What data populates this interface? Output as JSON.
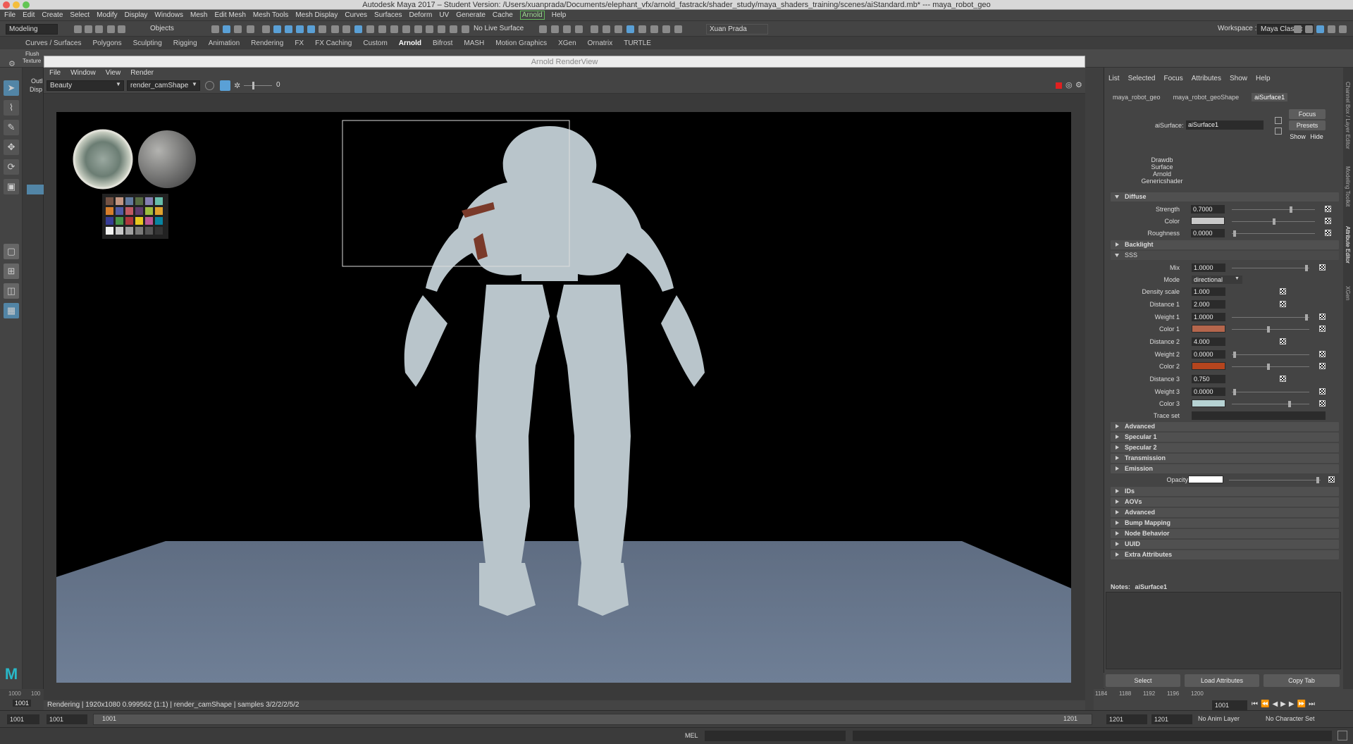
{
  "window": {
    "title": "Autodesk Maya 2017 – Student Version: /Users/xuanprada/Documents/elephant_vfx/arnold_fastrack/shader_study/maya_shaders_training/scenes/aiStandard.mb*  ---  maya_robot_geo"
  },
  "menubar": [
    "File",
    "Edit",
    "Create",
    "Select",
    "Modify",
    "Display",
    "Windows",
    "Mesh",
    "Edit Mesh",
    "Mesh Tools",
    "Mesh Display",
    "Curves",
    "Surfaces",
    "Deform",
    "UV",
    "Generate",
    "Cache",
    "Arnold",
    "Help"
  ],
  "statusline": {
    "mode": "Modeling",
    "selection_mode": "Objects",
    "live_surface": "No Live Surface",
    "user": "Xuan Prada",
    "workspace_label": "Workspace :",
    "workspace": "Maya Classic"
  },
  "shelf_tabs": [
    "Curves / Surfaces",
    "Polygons",
    "Sculpting",
    "Rigging",
    "Animation",
    "Rendering",
    "FX",
    "FX Caching",
    "Custom",
    "Arnold",
    "Bifrost",
    "MASH",
    "Motion Graphics",
    "XGen",
    "Ornatrix",
    "TURTLE"
  ],
  "shelf_icons": {
    "flush": "Flush",
    "texture": "Texture"
  },
  "outliner": {
    "tab": "Outl",
    "disp": "Disp"
  },
  "renderview": {
    "title": "Arnold RenderView",
    "menu": [
      "File",
      "Window",
      "View",
      "Render"
    ],
    "aov": "Beauty",
    "camera": "render_camShape",
    "exposure": "0",
    "status": "Rendering | 1920x1080 0.999562 (1:1) | render_camShape | samples 3/2/2/2/5/2"
  },
  "attribute_editor": {
    "menu": [
      "List",
      "Selected",
      "Focus",
      "Attributes",
      "Show",
      "Help"
    ],
    "node_tabs": [
      "maya_robot_geo",
      "maya_robot_geoShape",
      "aiSurface1"
    ],
    "node_label": "aiSurface:",
    "node_name": "aiSurface1",
    "buttons": {
      "focus": "Focus",
      "presets": "Presets",
      "show": "Show",
      "hide": "Hide"
    },
    "classification": [
      "Drawdb",
      "Surface",
      "Arnold",
      "Genericshader"
    ],
    "diffuse": {
      "title": "Diffuse",
      "strength_label": "Strength",
      "strength": "0.7000",
      "color_label": "Color",
      "color": "#c9c9c9",
      "roughness_label": "Roughness",
      "roughness": "0.0000"
    },
    "backlight": "Backlight",
    "sss": {
      "title": "SSS",
      "mix_label": "Mix",
      "mix": "1.0000",
      "mode_label": "Mode",
      "mode": "directional",
      "density_label": "Density scale",
      "density": "1.000",
      "distance1_label": "Distance 1",
      "distance1": "2.000",
      "weight1_label": "Weight 1",
      "weight1": "1.0000",
      "color1_label": "Color 1",
      "color1": "#b5664c",
      "distance2_label": "Distance 2",
      "distance2": "4.000",
      "weight2_label": "Weight 2",
      "weight2": "0.0000",
      "color2_label": "Color 2",
      "color2": "#b5451e",
      "distance3_label": "Distance 3",
      "distance3": "0.750",
      "weight3_label": "Weight 3",
      "weight3": "0.0000",
      "color3_label": "Color 3",
      "color3": "#b7d3d4",
      "traceset_label": "Trace set"
    },
    "sections_mid": [
      "Advanced",
      "Specular 1",
      "Specular 2",
      "Transmission",
      "Emission"
    ],
    "opacity_label": "Opacity",
    "opacity_color": "#ffffff",
    "sections_bottom": [
      "IDs",
      "AOVs",
      "Advanced",
      "Bump Mapping",
      "Node Behavior",
      "UUID",
      "Extra Attributes"
    ],
    "notes_label": "Notes:",
    "notes_node": "aiSurface1",
    "bottom_buttons": [
      "Select",
      "Load Attributes",
      "Copy Tab"
    ]
  },
  "side_tabs": [
    "Channel Box / Layer Editor",
    "Modeling Toolkit",
    "Attribute Editor",
    "XGen"
  ],
  "timeline": {
    "ticks": [
      "1184",
      "1188",
      "1192",
      "1196",
      "1200"
    ],
    "current": "1001"
  },
  "range": {
    "start": "1001",
    "anim_start": "1001",
    "range_start": "1001",
    "range_end": "1201",
    "end": "1201",
    "anim_end": "1201",
    "anim_layer": "No Anim Layer",
    "char_set": "No Character Set"
  },
  "left_timeline_ticks": [
    "1000",
    "100"
  ],
  "left_frame": "1001",
  "cmdline": {
    "label": "MEL"
  }
}
